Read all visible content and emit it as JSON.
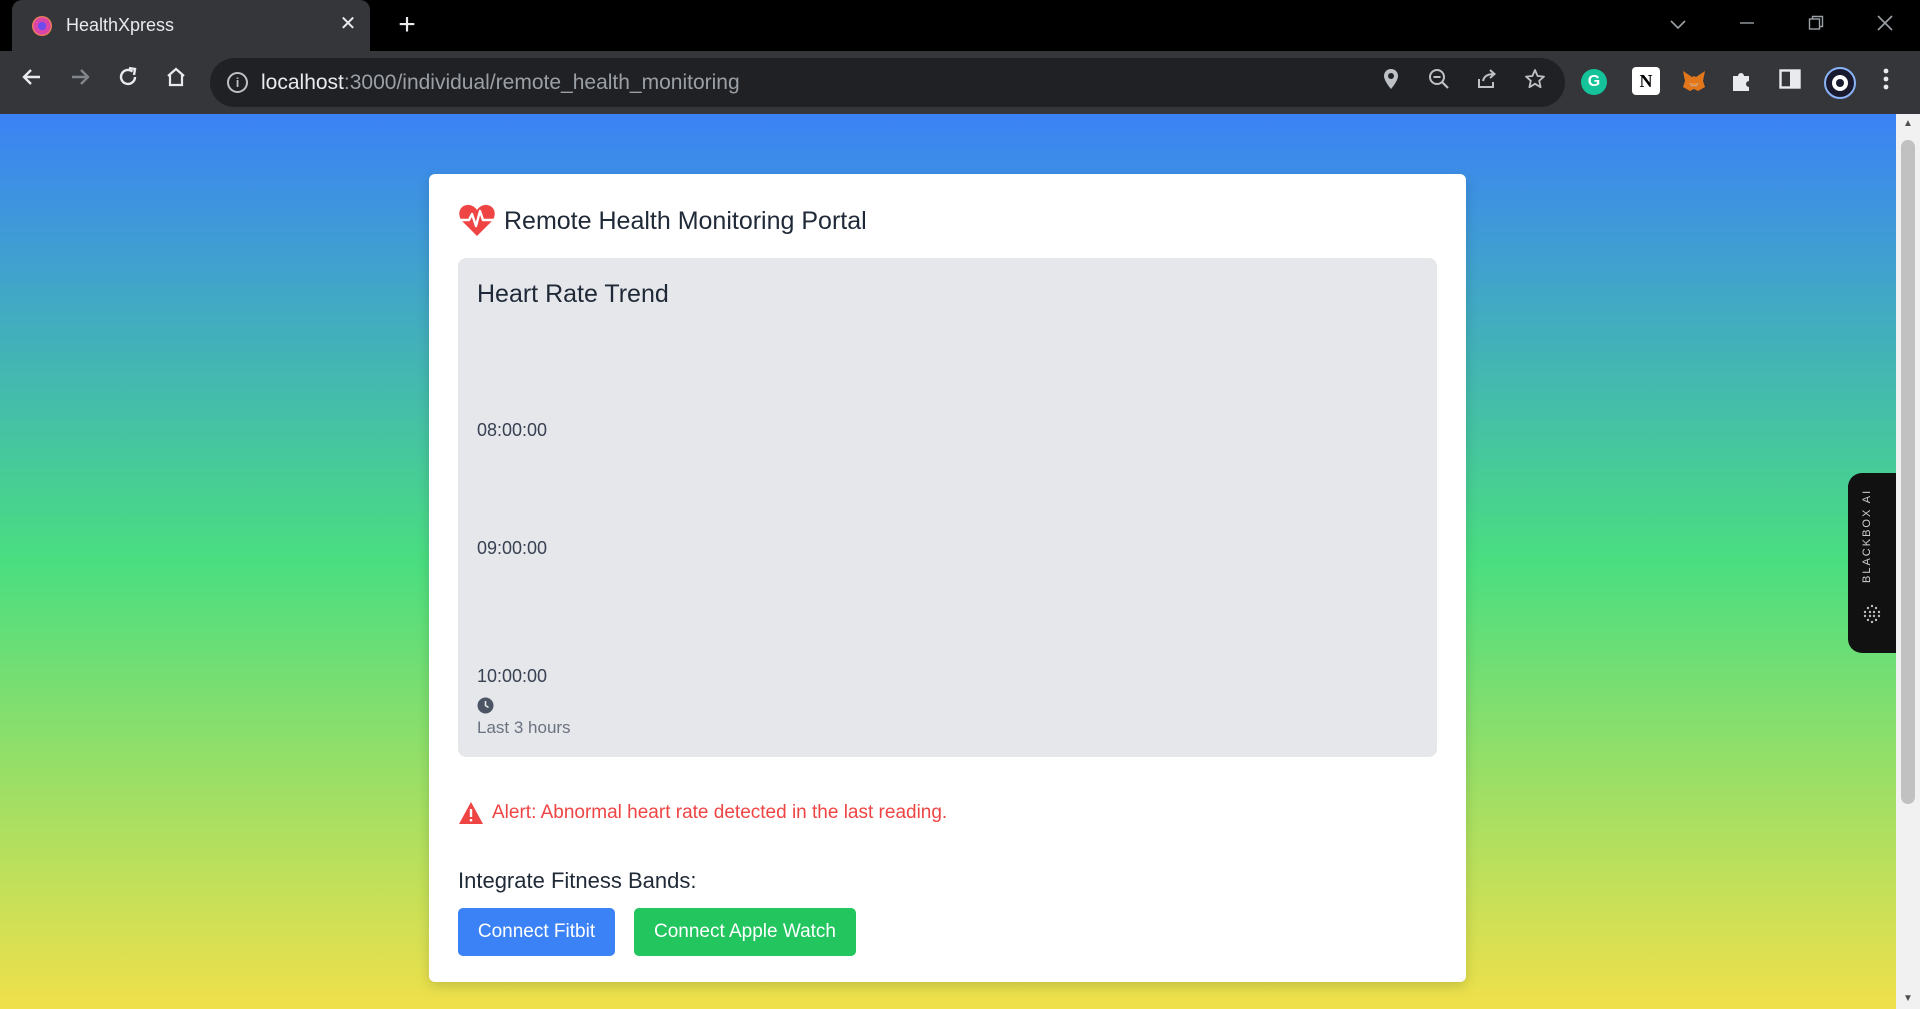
{
  "browser": {
    "tab_title": "HealthXpress",
    "tab_close_glyph": "✕",
    "new_tab_glyph": "+",
    "url_host": "localhost",
    "url_path": ":3000/individual/remote_health_monitoring",
    "icons": [
      "back-arrow-icon",
      "forward-arrow-icon",
      "reload-icon",
      "home-icon",
      "site-info-icon",
      "location-icon",
      "zoom-out-icon",
      "share-icon",
      "bookmark-star-icon",
      "grammarly-icon",
      "notion-icon",
      "metamask-icon",
      "extensions-puzzle-icon",
      "side-panel-icon",
      "profile-avatar-icon",
      "kebab-menu-icon"
    ]
  },
  "page": {
    "title": "Remote Health Monitoring Portal",
    "chart": {
      "title": "Heart Rate Trend",
      "times": [
        "08:00:00",
        "09:00:00",
        "10:00:00"
      ],
      "footer": "Last 3 hours"
    },
    "alert": "Alert: Abnormal heart rate detected in the last reading.",
    "integrate_title": "Integrate Fitness Bands:",
    "buttons": {
      "fitbit": "Connect Fitbit",
      "apple": "Connect Apple Watch"
    }
  },
  "sidebar_widget": {
    "label": "BLACKBOX AI"
  },
  "colors": {
    "gradient_top": "#3b82f6",
    "gradient_mid": "#4ade80",
    "gradient_bottom": "#f0e04a",
    "heart_red": "#ef4444",
    "fitbit_blue": "#3b82f6",
    "apple_green": "#22c55e"
  }
}
